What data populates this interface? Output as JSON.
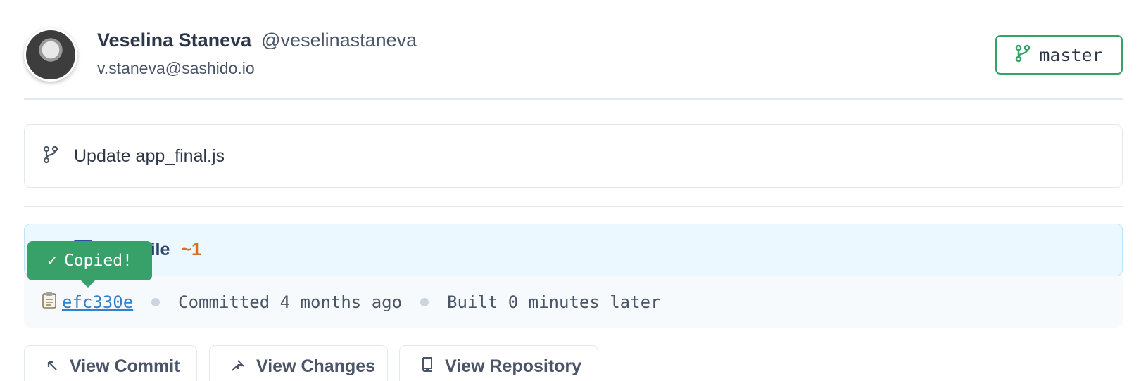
{
  "user": {
    "name": "Veselina Staneva",
    "handle": "@veselinastaneva",
    "email": "v.staneva@sashido.io"
  },
  "branch": {
    "label": "master",
    "icon": "git-branch-icon",
    "color": "#38a169"
  },
  "commit": {
    "icon": "git-branch-icon",
    "message": "Update app_final.js"
  },
  "changes": {
    "text": "Changed 1 file",
    "visible_text": "ged 1 file",
    "count": "~1",
    "count_color": "#dd6b20"
  },
  "tooltip": {
    "check": "✓",
    "text": "Copied!"
  },
  "meta": {
    "hash_icon": "clipboard-icon",
    "hash": "efc330e",
    "committed": "Committed 4 months ago",
    "built": "Built 0 minutes later"
  },
  "actions": {
    "view_commit": "View Commit",
    "view_changes": "View Changes",
    "view_repository": "View Repository"
  }
}
